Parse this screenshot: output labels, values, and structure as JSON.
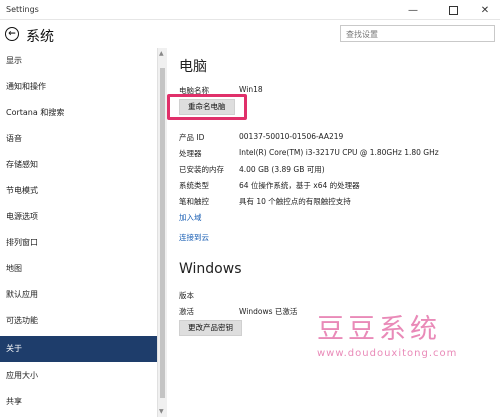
{
  "window": {
    "title": "Settings"
  },
  "header": {
    "app_title": "系统",
    "search_placeholder": "查找设置"
  },
  "sidebar": {
    "items": [
      {
        "label": "显示"
      },
      {
        "label": "通知和操作"
      },
      {
        "label": "Cortana 和搜索"
      },
      {
        "label": "语音"
      },
      {
        "label": "存储感知"
      },
      {
        "label": "节电模式"
      },
      {
        "label": "电源选项"
      },
      {
        "label": "排列窗口"
      },
      {
        "label": "地图"
      },
      {
        "label": "默认应用"
      },
      {
        "label": "可选功能"
      },
      {
        "label": "关于",
        "active": true
      },
      {
        "label": "应用大小"
      },
      {
        "label": "共享"
      }
    ]
  },
  "pc": {
    "title": "电脑",
    "name_label": "电脑名称",
    "name_value": "Win18",
    "rename_button": "重命名电脑",
    "specs": [
      {
        "label": "产品 ID",
        "value": "00137-50010-01506-AA219"
      },
      {
        "label": "处理器",
        "value": "Intel(R) Core(TM) i3-3217U CPU @ 1.80GHz   1.80 GHz"
      },
      {
        "label": "已安装的内存",
        "value": "4.00 GB (3.89 GB 可用)"
      },
      {
        "label": "系统类型",
        "value": "64 位操作系统，基于 x64 的处理器"
      },
      {
        "label": "笔和触控",
        "value": "具有 10 个触控点的有限触控支持"
      }
    ],
    "join_domain_link": "加入域",
    "connect_cloud_link": "连接到云"
  },
  "windows": {
    "title": "Windows",
    "edition_label": "版本",
    "activation_label": "激活",
    "activation_value": "Windows 已激活",
    "change_key_button": "更改产品密钥"
  },
  "watermark": {
    "title": "豆豆系统",
    "url": "www.doudouxitong.com"
  },
  "colors": {
    "sidebar_active": "#1e3d6b",
    "highlight": "#e0306a",
    "link": "#1a5fb4",
    "watermark": "#e98ab8"
  }
}
